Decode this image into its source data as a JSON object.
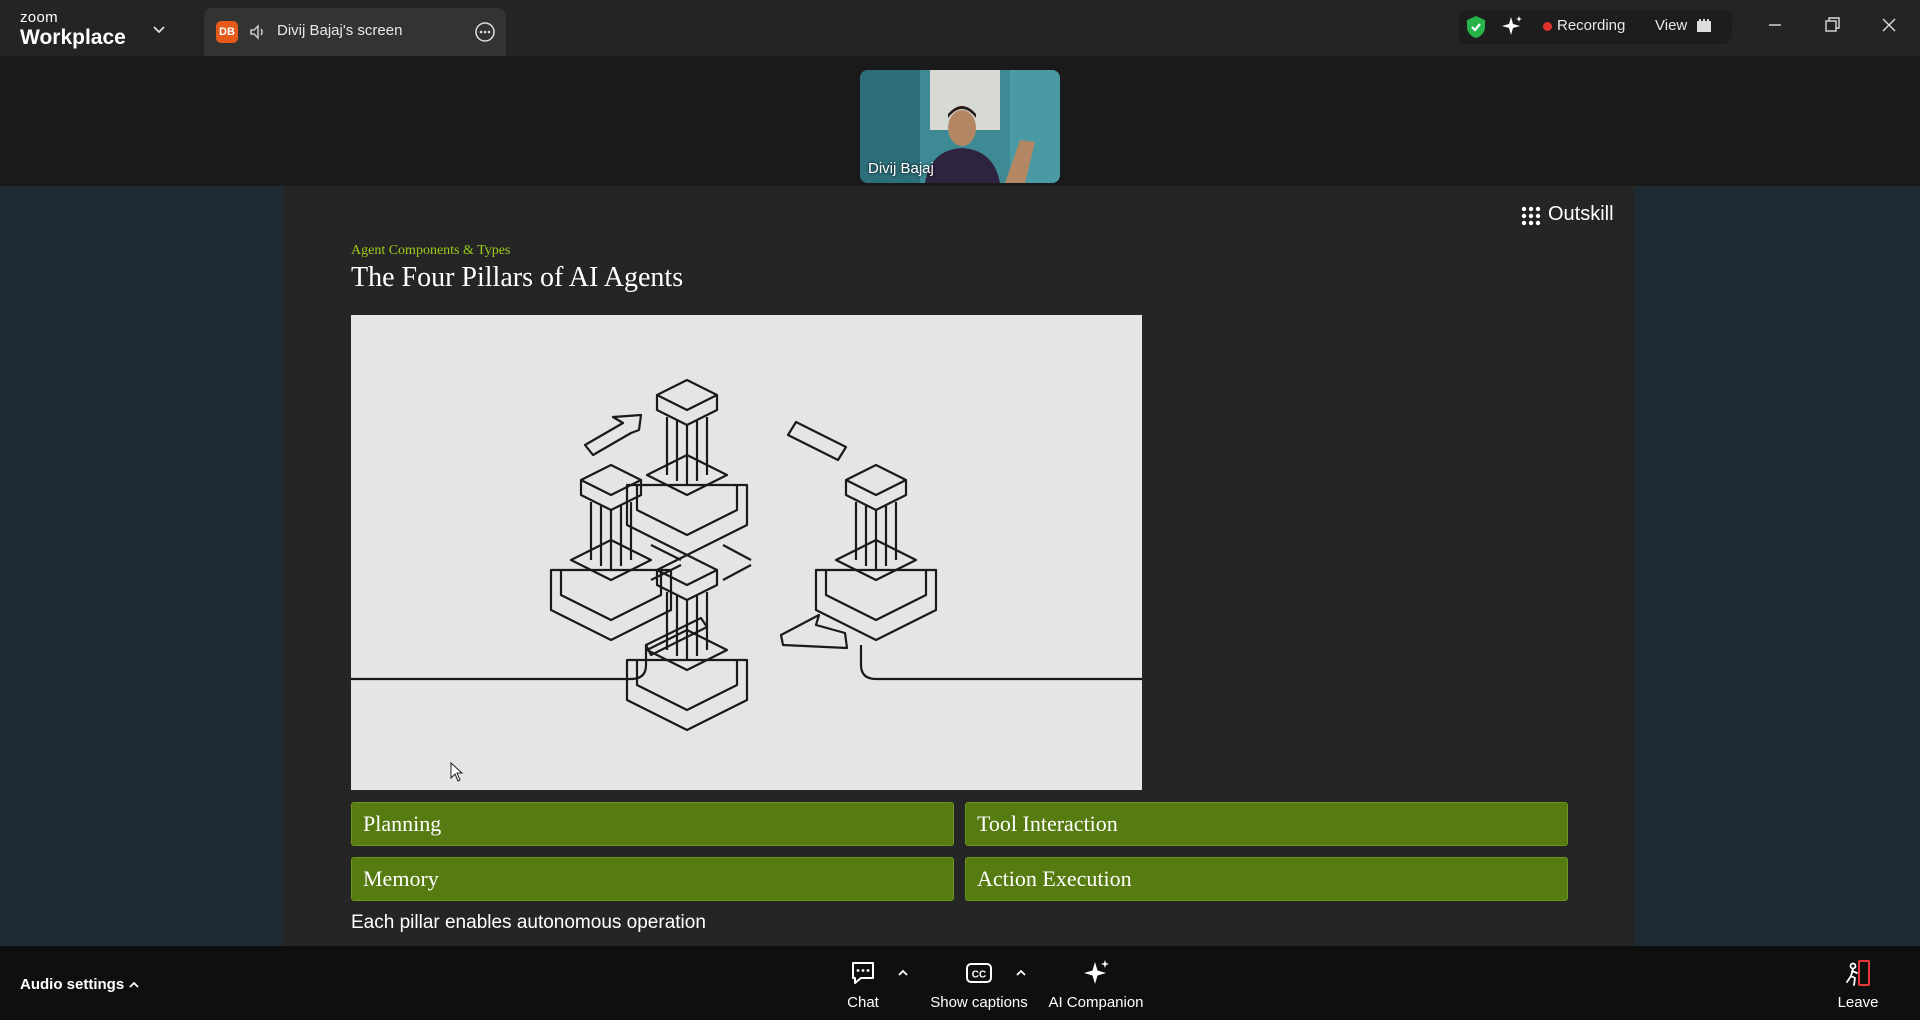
{
  "app": {
    "brand_small": "zoom",
    "brand_large": "Workplace"
  },
  "tab": {
    "badge": "DB",
    "title": "Divij Bajaj's screen"
  },
  "status": {
    "recording_label": "Recording",
    "view_label": "View"
  },
  "video": {
    "participant_name": "Divij Bajaj"
  },
  "slide": {
    "brand": "Outskill",
    "eyebrow": "Agent Components & Types",
    "title": "The Four Pillars of AI Agents",
    "pillars": [
      "Planning",
      "Tool Interaction",
      "Memory",
      "Action Execution"
    ],
    "caption": "Each pillar enables autonomous operation",
    "colors": {
      "accent": "#9acd1c",
      "pillar_bg": "#567b11"
    }
  },
  "toolbar": {
    "audio_settings": "Audio settings",
    "chat": "Chat",
    "captions": "Show captions",
    "ai_companion": "AI Companion",
    "leave": "Leave"
  },
  "icons": [
    "chevron-down-icon",
    "speaker-icon",
    "more-icon",
    "shield-icon",
    "ai-sparkle-icon",
    "view-grid-icon",
    "minimize-icon",
    "restore-icon",
    "close-icon",
    "chat-icon",
    "cc-icon",
    "leave-icon",
    "apps-dots-icon"
  ]
}
